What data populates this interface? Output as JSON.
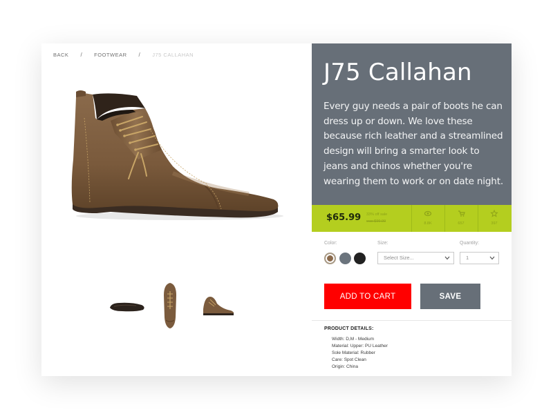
{
  "breadcrumb": {
    "items": [
      "BACK",
      "FOOTWEAR",
      "J75 CALLAHAN"
    ],
    "separator": "/"
  },
  "product": {
    "title": "J75 Callahan",
    "description": "Every guy needs a pair of boots he can dress up or down. We love these because rich leather and a streamlined design will bring a smarter look to jeans and chinos whether you're wearing them to work or on date night."
  },
  "pricing": {
    "price": "$65.99",
    "discount_text": "33% off sale",
    "original_price": "was $99.99",
    "stats": [
      {
        "icon": "eye-icon",
        "value": "8.8K"
      },
      {
        "icon": "cart-icon",
        "value": "657"
      },
      {
        "icon": "star-icon",
        "value": "397"
      }
    ]
  },
  "options": {
    "color_label": "Color:",
    "colors": [
      {
        "name": "tan",
        "hex": "#8b6a4c",
        "selected": true
      },
      {
        "name": "gray",
        "hex": "#6b747d",
        "selected": false
      },
      {
        "name": "black",
        "hex": "#222222",
        "selected": false
      }
    ],
    "size_label": "Size:",
    "size_placeholder": "Select Size...",
    "quantity_label": "Quantity:",
    "quantity_value": "1"
  },
  "actions": {
    "add_to_cart": "ADD TO CART",
    "save": "SAVE"
  },
  "details": {
    "title": "PRODUCT DETAILS:",
    "items": [
      "Width: D,M - Medium",
      "Material: Upper: PU Leather",
      "Sole Material: Rubber",
      "Care: Spot Clean",
      "Origin: China"
    ]
  },
  "colors": {
    "hero_bg": "#676f78",
    "accent_green": "#b4ce1f",
    "cart_red": "#ff0000"
  }
}
